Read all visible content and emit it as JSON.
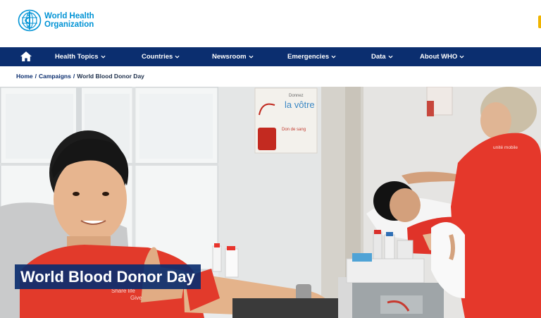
{
  "header": {
    "logo_line1": "World Health",
    "logo_line2": "Organization"
  },
  "nav": {
    "items": [
      {
        "label": "Health Topics"
      },
      {
        "label": "Countries"
      },
      {
        "label": "Newsroom"
      },
      {
        "label": "Emergencies"
      },
      {
        "label": "Data"
      },
      {
        "label": "About WHO"
      }
    ]
  },
  "breadcrumb": {
    "home": "Home",
    "campaigns": "Campaigns",
    "current": "World Blood Donor Day"
  },
  "hero": {
    "title": "World Blood Donor Day",
    "poster_line1": "Donnez",
    "poster_line2": "la vôtre",
    "poster_line3": "Don de sang",
    "shirt_text_1": "Share life",
    "shirt_text_2": "Give",
    "shirt_text_3": "unité mobile"
  },
  "colors": {
    "brand_blue": "#0093d5",
    "nav_navy": "#0b2e6f",
    "shirt_red": "#e8352b"
  }
}
